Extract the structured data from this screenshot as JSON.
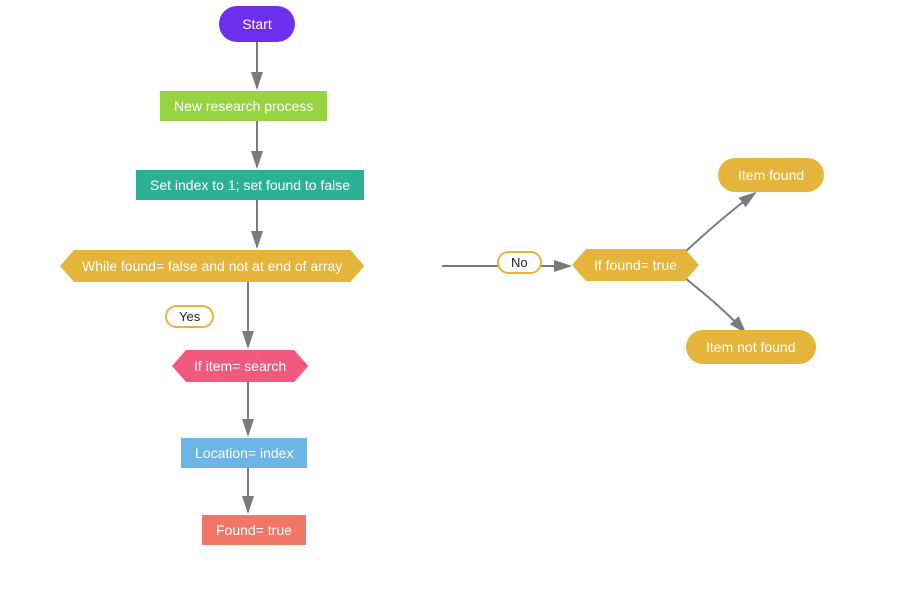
{
  "nodes": {
    "start": "Start",
    "new_research": "New research process",
    "set_index": "Set index to 1; set found to false",
    "while_cond": "While found= false and not at end of array",
    "if_item": "If item= search",
    "location": "Location= index",
    "found_true": "Found= true",
    "if_found": "If found= true",
    "item_found": "Item found",
    "item_not_found": "Item not found"
  },
  "labels": {
    "yes": "Yes",
    "no": "No"
  },
  "colors": {
    "start": "#6e2eed",
    "green": "#98d442",
    "teal": "#2cb194",
    "yellow": "#e5b43a",
    "pink": "#f15a7c",
    "blue": "#6db5e7",
    "red": "#f07765",
    "arrow": "#7a7a7a"
  }
}
